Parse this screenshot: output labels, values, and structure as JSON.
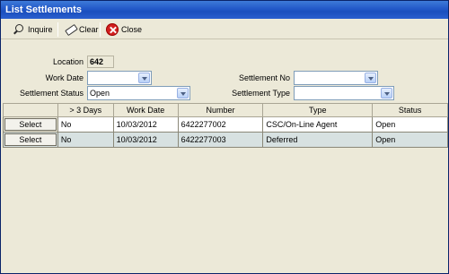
{
  "window": {
    "title": "List Settlements"
  },
  "toolbar": {
    "inquire_label": "Inquire",
    "clear_label": "Clear",
    "close_label": "Close"
  },
  "form": {
    "location_label": "Location",
    "location_value": "642",
    "work_date_label": "Work Date",
    "work_date_value": "",
    "settlement_status_label": "Settlement Status",
    "settlement_status_value": "Open",
    "settlement_no_label": "Settlement No",
    "settlement_no_value": "",
    "settlement_type_label": "Settlement Type",
    "settlement_type_value": ""
  },
  "table": {
    "columns": [
      "",
      "> 3 Days",
      "Work Date",
      "Number",
      "Type",
      "Status"
    ],
    "select_label": "Select",
    "rows": [
      {
        "three_days": "No",
        "work_date": "10/03/2012",
        "number": "6422277002",
        "type": "CSC/On-Line Agent",
        "status": "Open"
      },
      {
        "three_days": "No",
        "work_date": "10/03/2012",
        "number": "6422277003",
        "type": "Deferred",
        "status": "Open"
      }
    ]
  },
  "icons": {
    "inquire": "search-icon",
    "clear": "eraser-icon",
    "close": "close-icon"
  },
  "colors": {
    "titlebar": "#2258c8",
    "alt_row": "#d7e1e1",
    "background": "#ece9d8"
  }
}
